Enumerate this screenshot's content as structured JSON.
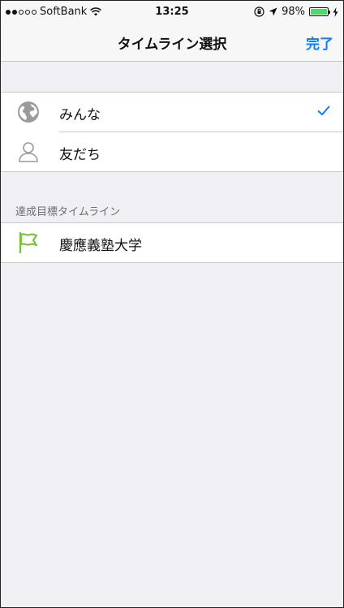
{
  "status_bar": {
    "carrier": "SoftBank",
    "time": "13:25",
    "battery": "98%",
    "battery_level": 0.98
  },
  "nav": {
    "title": "タイムライン選択",
    "done_label": "完了"
  },
  "timeline_options": [
    {
      "label": "みんな",
      "icon": "globe-icon",
      "selected": true
    },
    {
      "label": "友だち",
      "icon": "person-icon",
      "selected": false
    }
  ],
  "goal_section": {
    "header": "達成目標タイムライン",
    "items": [
      {
        "label": "慶應義塾大学",
        "icon": "flag-icon",
        "color": "#7cc242"
      }
    ]
  },
  "colors": {
    "accent": "#0a7cff",
    "background": "#efeff4",
    "flag": "#7cc242",
    "icon_gray": "#9a9a9f"
  }
}
